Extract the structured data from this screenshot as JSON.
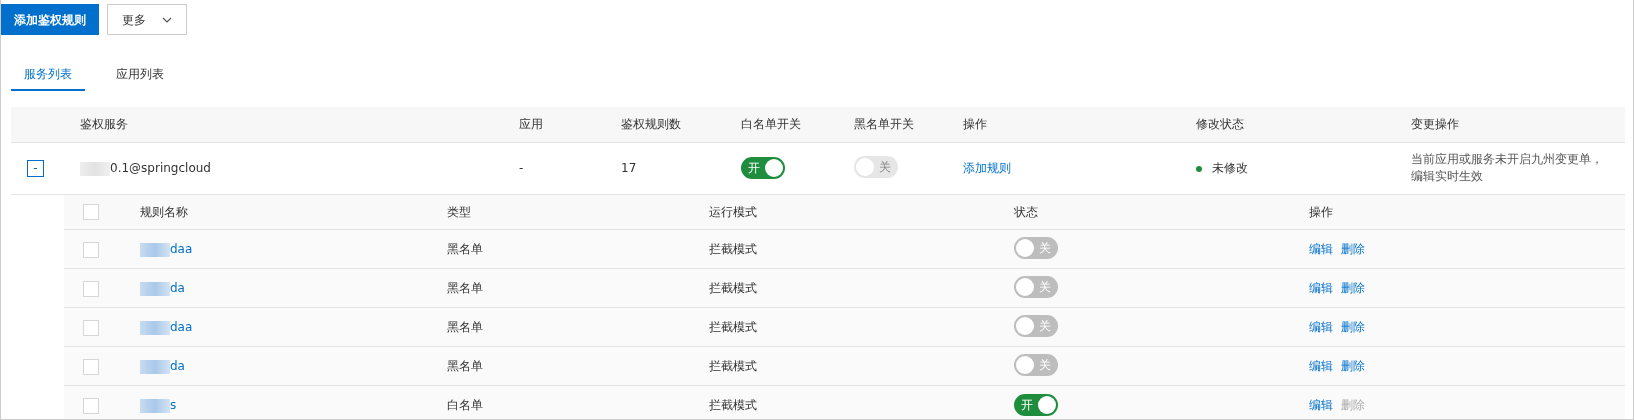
{
  "toolbar": {
    "buttons": [
      {
        "label": "添加鉴权规则",
        "kind": "primary"
      },
      {
        "label": "更多",
        "kind": "dropdown"
      }
    ]
  },
  "tabs": [
    {
      "label": "服务列表",
      "selected": true
    },
    {
      "label": "应用列表",
      "selected": false
    }
  ],
  "table": {
    "columns": [
      "鉴权服务",
      "应用",
      "鉴权规则数",
      "白名单开关",
      "黑名单开关",
      "操作",
      "修改状态",
      "变更操作"
    ],
    "rows": [
      {
        "expanded": true,
        "expand_symbol": "-",
        "service": "0.1@springcloud",
        "app": "-",
        "rule_count": "17",
        "whitelist": {
          "on": true,
          "disabled": false,
          "label": "开"
        },
        "blacklist": {
          "on": false,
          "disabled": true,
          "label": "关"
        },
        "action": "添加规则",
        "status": {
          "text": "未修改",
          "color": "#1e8e3e"
        },
        "change_note": "当前应用或服务未开启九州变更单，编辑实时生效",
        "rules": {
          "select_all_checked": false,
          "columns": [
            "规则名称",
            "类型",
            "运行模式",
            "状态",
            "操作"
          ],
          "rows": [
            {
              "checked": false,
              "name": "daa",
              "type": "黑名单",
              "mode": "拦截模式",
              "switch": {
                "on": false,
                "label": "关"
              },
              "actions": [
                {
                  "label": "编辑",
                  "disabled": false
                },
                {
                  "label": "删除",
                  "disabled": false
                }
              ]
            },
            {
              "checked": false,
              "name": "da",
              "type": "黑名单",
              "mode": "拦截模式",
              "switch": {
                "on": false,
                "label": "关"
              },
              "actions": [
                {
                  "label": "编辑",
                  "disabled": false
                },
                {
                  "label": "删除",
                  "disabled": false
                }
              ]
            },
            {
              "checked": false,
              "name": "daa",
              "type": "黑名单",
              "mode": "拦截模式",
              "switch": {
                "on": false,
                "label": "关"
              },
              "actions": [
                {
                  "label": "编辑",
                  "disabled": false
                },
                {
                  "label": "删除",
                  "disabled": false
                }
              ]
            },
            {
              "checked": false,
              "name": "da",
              "type": "黑名单",
              "mode": "拦截模式",
              "switch": {
                "on": false,
                "label": "关"
              },
              "actions": [
                {
                  "label": "编辑",
                  "disabled": false
                },
                {
                  "label": "删除",
                  "disabled": false
                }
              ]
            },
            {
              "checked": false,
              "name": "s",
              "type": "白名单",
              "mode": "拦截模式",
              "switch": {
                "on": true,
                "label": "开"
              },
              "actions": [
                {
                  "label": "编辑",
                  "disabled": false
                },
                {
                  "label": "删除",
                  "disabled": true
                }
              ]
            }
          ]
        }
      }
    ]
  }
}
